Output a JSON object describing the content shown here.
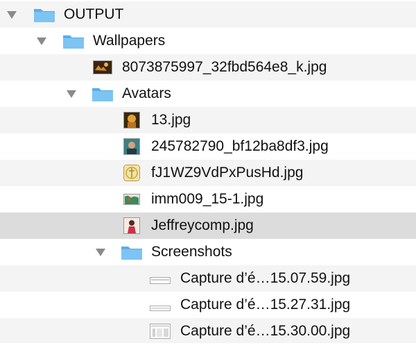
{
  "tree": {
    "rows": [
      {
        "label": "OUTPUT",
        "kind": "folder",
        "expanded": true,
        "icon": "folder-icon"
      },
      {
        "label": "Wallpapers",
        "kind": "folder",
        "expanded": true,
        "icon": "folder-icon"
      },
      {
        "label": "8073875997_32fbd564e8_k.jpg",
        "kind": "file",
        "icon": "image-thumbnail-icon"
      },
      {
        "label": "Avatars",
        "kind": "folder",
        "expanded": true,
        "icon": "folder-icon"
      },
      {
        "label": "13.jpg",
        "kind": "file",
        "icon": "image-thumbnail-icon"
      },
      {
        "label": "245782790_bf12ba8df3.jpg",
        "kind": "file",
        "icon": "image-thumbnail-icon"
      },
      {
        "label": "fJ1WZ9VdPxPusHd.jpg",
        "kind": "file",
        "icon": "image-thumbnail-icon"
      },
      {
        "label": "imm009_15-1.jpg",
        "kind": "file",
        "icon": "image-thumbnail-icon"
      },
      {
        "label": "Jeffreycomp.jpg",
        "kind": "file",
        "icon": "image-thumbnail-icon",
        "selected": true
      },
      {
        "label": "Screenshots",
        "kind": "folder",
        "expanded": true,
        "icon": "folder-icon"
      },
      {
        "label": "Capture d’é…15.07.59.jpg",
        "kind": "file",
        "icon": "screenshot-thumbnail-icon"
      },
      {
        "label": "Capture d’é…15.27.31.jpg",
        "kind": "file",
        "icon": "screenshot-thumbnail-icon"
      },
      {
        "label": "Capture d’é…15.30.00.jpg",
        "kind": "file",
        "icon": "screenshot-thumbnail-icon"
      }
    ]
  },
  "colors": {
    "folder": "#7cc4f2",
    "folder_dark": "#5aaee6",
    "stripe": "#f4f4f4",
    "selected": "#dcdcdc",
    "disclosure": "#8a8a8a"
  }
}
